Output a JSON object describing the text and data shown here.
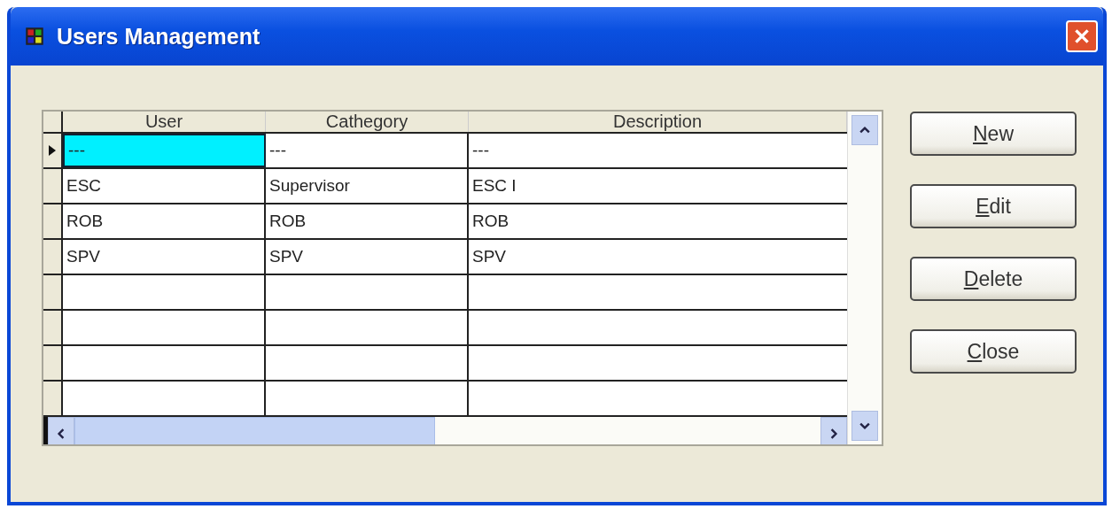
{
  "window": {
    "title": "Users Management"
  },
  "table": {
    "columns": [
      "User",
      "Cathegory",
      "Description"
    ],
    "rows": [
      {
        "selected": true,
        "cells": [
          "---",
          "---",
          "---"
        ]
      },
      {
        "selected": false,
        "cells": [
          "ESC",
          "Supervisor",
          "ESC I"
        ]
      },
      {
        "selected": false,
        "cells": [
          "ROB",
          "ROB",
          "ROB"
        ]
      },
      {
        "selected": false,
        "cells": [
          "SPV",
          "SPV",
          "SPV"
        ]
      }
    ]
  },
  "buttons": [
    "New",
    "Edit",
    "Delete",
    "Close"
  ]
}
